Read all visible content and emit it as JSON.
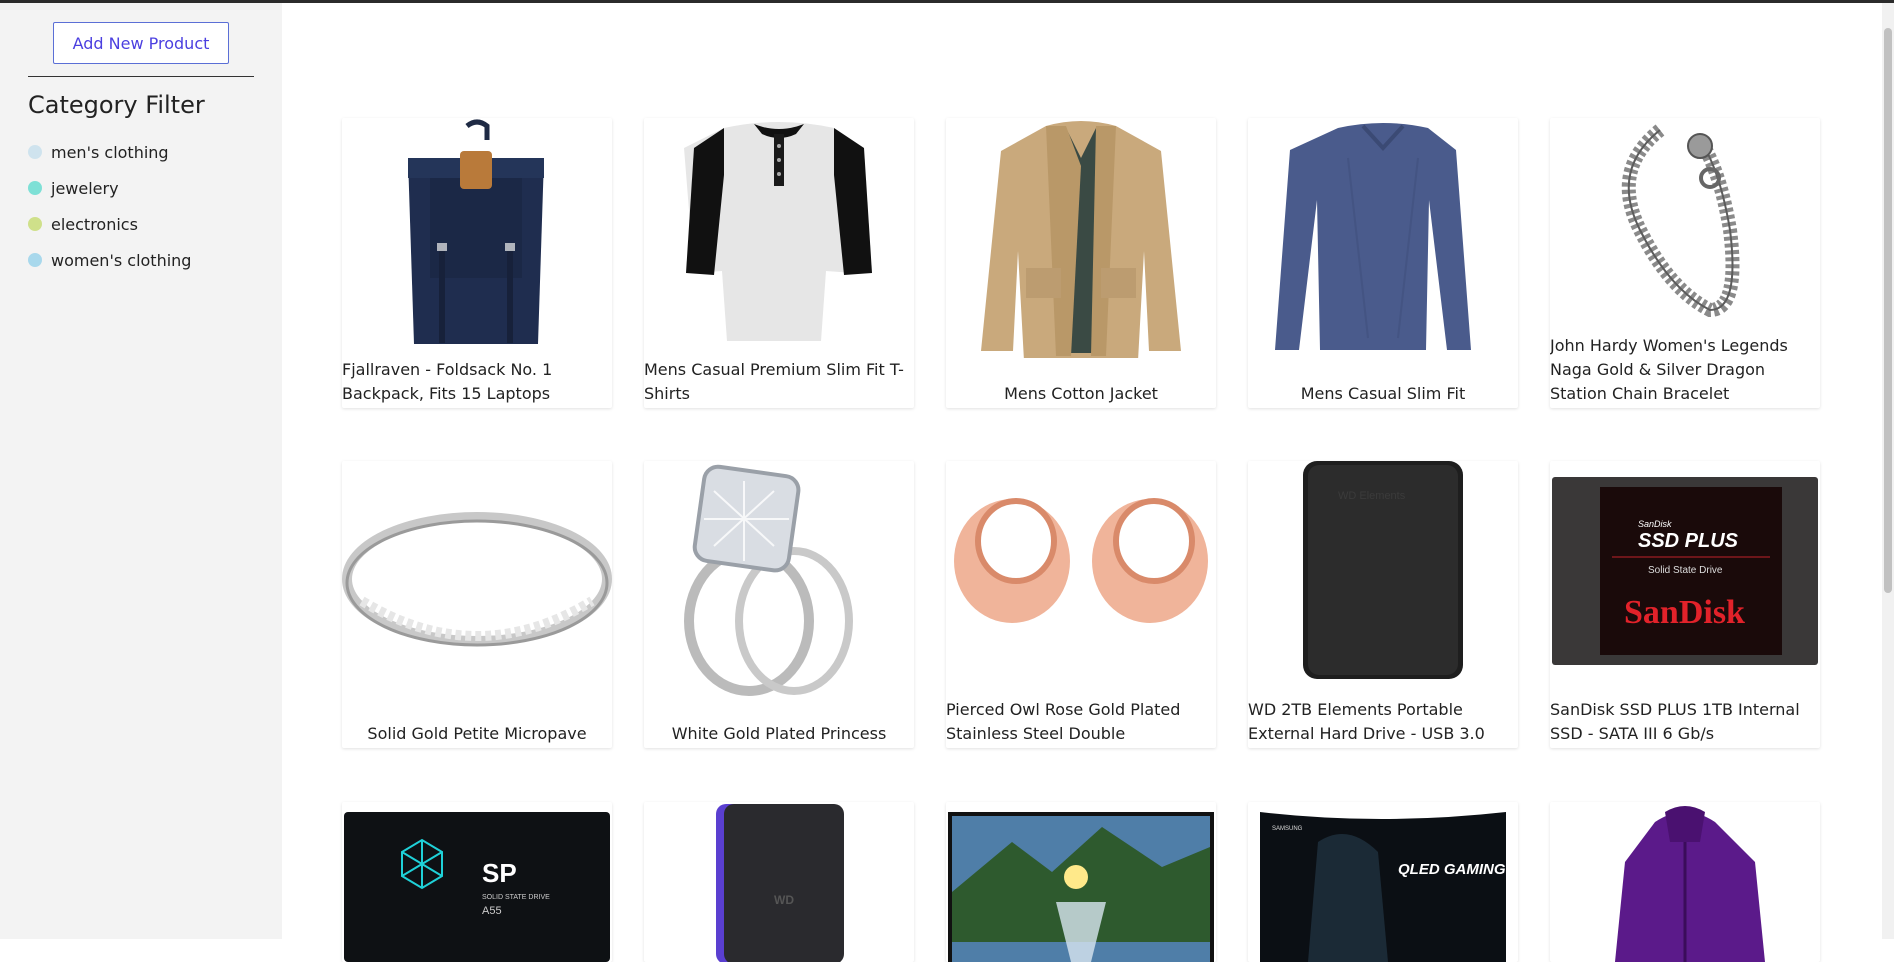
{
  "sidebar": {
    "add_button": "Add New Product",
    "filter_title": "Category Filter",
    "categories": [
      {
        "label": "men's clothing",
        "color": "#cfe3ee"
      },
      {
        "label": "jewelery",
        "color": "#7ee0d6"
      },
      {
        "label": "electronics",
        "color": "#cfe08a"
      },
      {
        "label": "women's clothing",
        "color": "#a8d8ec"
      }
    ]
  },
  "products": [
    {
      "title": "Fjallraven - Foldsack No. 1 Backpack, Fits 15 Laptops",
      "icon": "backpack-image"
    },
    {
      "title": "Mens Casual Premium Slim Fit T-Shirts",
      "icon": "tshirt-image"
    },
    {
      "title": "Mens Cotton Jacket",
      "icon": "jacket-image"
    },
    {
      "title": "Mens Casual Slim Fit",
      "icon": "longsleeve-image"
    },
    {
      "title": "John Hardy Women's Legends Naga Gold & Silver Dragon Station Chain Bracelet",
      "icon": "bracelet-image"
    },
    {
      "title": "Solid Gold Petite Micropave",
      "icon": "ring-image"
    },
    {
      "title": "White Gold Plated Princess",
      "icon": "diamond-ring-image"
    },
    {
      "title": "Pierced Owl Rose Gold Plated Stainless Steel Double",
      "icon": "earrings-image"
    },
    {
      "title": "WD 2TB Elements Portable External Hard Drive - USB 3.0",
      "icon": "hard-drive-image"
    },
    {
      "title": "SanDisk SSD PLUS 1TB Internal SSD - SATA III 6 Gb/s",
      "icon": "ssd-image"
    },
    {
      "title": "",
      "icon": "sp-ssd-image"
    },
    {
      "title": "",
      "icon": "wd-drive-image"
    },
    {
      "title": "",
      "icon": "monitor-image"
    },
    {
      "title": "",
      "icon": "curved-monitor-image"
    },
    {
      "title": "",
      "icon": "womens-jacket-image"
    }
  ],
  "image_text": {
    "ssd_brand": "SanDisk",
    "ssd_product": "SSD PLUS",
    "ssd_sub": "Solid State Drive",
    "ssd_logo": "SanDisk",
    "wd_label": "WD Elements",
    "sp_logo": "SP",
    "sp_text": "SOLID STATE DRIVE",
    "sp_model": "A55",
    "wd_small": "WD",
    "samsung": "SAMSUNG",
    "monitor_text": "QLED GAMING MONITOR"
  }
}
